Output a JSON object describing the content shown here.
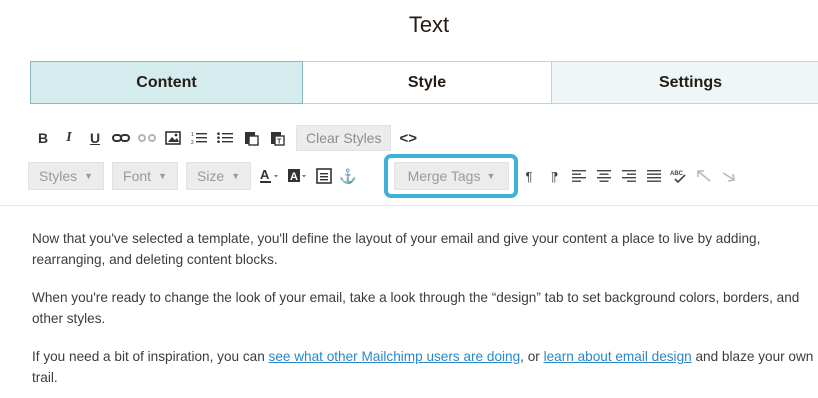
{
  "title": "Text",
  "tabs": [
    {
      "label": "Content",
      "active": true
    },
    {
      "label": "Style"
    },
    {
      "label": "Settings"
    }
  ],
  "toolbar_row1": {
    "icons": [
      "bold-icon",
      "italic-icon",
      "underline-icon",
      "link-icon",
      "unlink-icon",
      "image-icon",
      "ordered-list-icon",
      "unordered-list-icon",
      "paste-icon",
      "paste-text-icon"
    ],
    "clear_styles_label": "Clear Styles",
    "code_icon": "<>"
  },
  "toolbar_row2": {
    "styles_label": "Styles",
    "font_label": "Font",
    "size_label": "Size",
    "merge_tags_label": "Merge Tags",
    "icons": [
      "text-color-icon",
      "background-color-icon",
      "block-icon",
      "anchor-icon",
      "paragraph-ltr-icon",
      "paragraph-rtl-icon",
      "align-left-icon",
      "align-center-icon",
      "align-right-icon",
      "align-justify-icon",
      "spellcheck-icon",
      "undo-icon",
      "redo-icon"
    ]
  },
  "highlight_color": "#3fb2d7",
  "body": {
    "p1": "Now that you've selected a template, you'll define the layout of your email and give your content a place to live by adding, rearranging, and deleting content blocks.",
    "p2": "When you're ready to change the look of your email, take a look through the “design” tab to set background colors, borders, and other styles.",
    "p3_pre": "If you need a bit of inspiration, you can ",
    "p3_link1": "see what other Mailchimp users are doing",
    "p3_mid": ", or ",
    "p3_link2": "learn about email design",
    "p3_post": " and blaze your own trail."
  }
}
